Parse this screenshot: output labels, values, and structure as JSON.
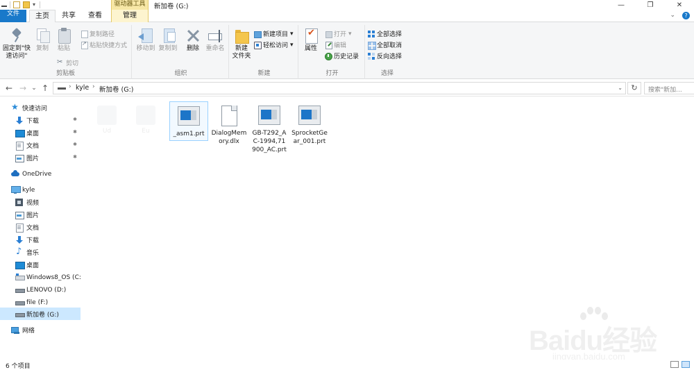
{
  "window": {
    "title": "新加卷 (G:)",
    "contextual_group": "驱动器工具",
    "controls": {
      "minimize": "—",
      "maximize": "❐",
      "close": "✕"
    }
  },
  "ribbon_tabs": {
    "file": "文件",
    "home": "主页",
    "share": "共享",
    "view": "查看",
    "manage": "管理",
    "expand": "⌄",
    "help": "?"
  },
  "ribbon": {
    "clipboard": {
      "label": "剪贴板",
      "pin": "固定到\"快速访问\"",
      "copy": "复制",
      "paste": "粘贴",
      "copy_path": "复制路径",
      "paste_shortcut": "粘贴快捷方式",
      "cut": "剪切"
    },
    "organize": {
      "label": "组织",
      "move_to": "移动到",
      "copy_to": "复制到",
      "delete": "删除",
      "rename": "重命名"
    },
    "new": {
      "label": "新建",
      "new_folder": "新建\n文件夹",
      "new_item": "新建项目",
      "easy_access": "轻松访问"
    },
    "open": {
      "label": "打开",
      "properties": "属性",
      "open": "打开",
      "edit": "编辑",
      "history": "历史记录"
    },
    "select": {
      "label": "选择",
      "select_all": "全部选择",
      "select_none": "全部取消",
      "invert": "反向选择"
    }
  },
  "address_bar": {
    "back": "←",
    "forward": "→",
    "recent": "⌄",
    "up": "↑",
    "crumbs": [
      "kyle",
      "新加卷 (G:)"
    ],
    "separator": "›",
    "dropdown": "⌄",
    "refresh": "↻",
    "search_placeholder": "搜索\"新加..."
  },
  "nav_pane": {
    "quick_access": "快速访问",
    "quick_items": [
      "下载",
      "桌面",
      "文档",
      "图片"
    ],
    "pin_glyph": "✱",
    "onedrive": "OneDrive",
    "this_pc": "kyle",
    "pc_items": [
      "视频",
      "图片",
      "文档",
      "下载",
      "音乐",
      "桌面",
      "Windows8_OS (C:)",
      "LENOVO (D:)",
      "file (F:)",
      "新加卷 (G:)"
    ],
    "network": "网络"
  },
  "files": [
    {
      "name": "_asm1.prt",
      "icon": "prt-file-icon"
    },
    {
      "name": "DialogMemory.dlx",
      "icon": "document-file-icon"
    },
    {
      "name": "GB-T292_AC-1994,71900_AC.prt",
      "icon": "prt-file-icon"
    },
    {
      "name": "SprocketGear_001.prt",
      "icon": "prt-file-icon"
    }
  ],
  "ghost_items": [
    "Ud",
    "Eu"
  ],
  "status": {
    "count": "6 个项目"
  },
  "watermark": {
    "brand": "Baidu经验",
    "url": "jingyan.baidu.com"
  }
}
